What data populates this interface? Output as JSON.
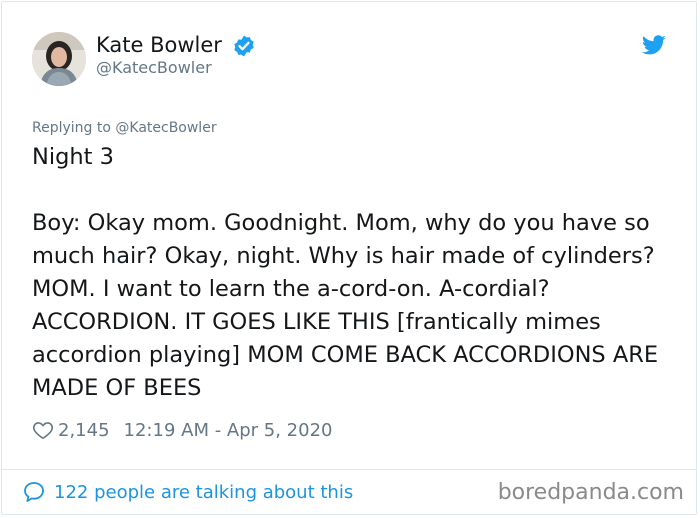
{
  "author": {
    "display_name": "Kate Bowler",
    "handle": "@KatecBowler",
    "verified": true,
    "avatar": "profile-photo"
  },
  "tweet": {
    "replying_to": "Replying to @KatecBowler",
    "paragraphs": [
      "Night 3",
      "Boy: Okay mom. Goodnight. Mom, why do you have so much hair? Okay, night. Why is hair made of cylinders? MOM. I want to learn the a-cord-on. A-cordial? ACCORDION. IT GOES LIKE THIS [frantically mimes accordion playing] MOM COME BACK ACCORDIONS ARE MADE OF BEES"
    ],
    "likes": "2,145",
    "timestamp": "12:19 AM - Apr 5, 2020"
  },
  "footer": {
    "talking_label": "122 people are talking about this",
    "watermark": "boredpanda.com"
  },
  "icons": {
    "verified": "verified-badge-icon",
    "bird": "twitter-bird-icon",
    "heart": "heart-icon",
    "bubble": "comment-bubble-icon"
  },
  "colors": {
    "accent": "#1da1f2",
    "link": "#1b95e0",
    "muted": "#657786",
    "text": "#14171a",
    "border": "#e1e8ed",
    "watermark": "#8a8a8a"
  }
}
